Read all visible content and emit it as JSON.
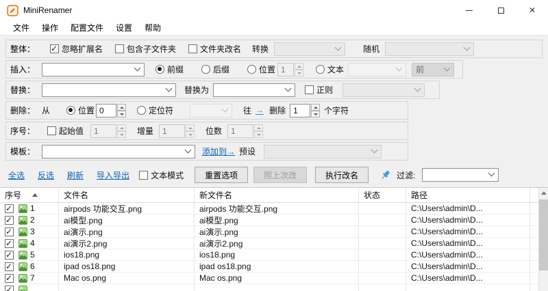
{
  "window": {
    "title": "MiniRenamer"
  },
  "menu": {
    "items": [
      "文件",
      "操作",
      "配置文件",
      "设置",
      "帮助"
    ]
  },
  "options": {
    "overall": {
      "label": "整体：",
      "ignore_ext": "忽略扩展名",
      "include_subfolders": "包含子文件夹",
      "rename_folders": "文件夹改名",
      "convert": "转换",
      "random": "随机"
    },
    "insert": {
      "label": "插入：",
      "prefix": "前缀",
      "suffix": "后缀",
      "position": "位置",
      "position_value": "1",
      "text": "文本",
      "front": "前"
    },
    "replace": {
      "label": "替换：",
      "with_label": "替换为",
      "regex": "正则"
    },
    "remove": {
      "label": "删除：",
      "from": "从",
      "position": "位置",
      "position_value": "0",
      "locator": "定位符",
      "toward": "往",
      "arrow": "→",
      "delete_label": "删除",
      "count_value": "1",
      "chars": "个字符"
    },
    "serial": {
      "label": "序号：",
      "start": "起始值",
      "start_value": "1",
      "increment": "增量",
      "increment_value": "1",
      "digits": "位数",
      "digits_value": "1"
    },
    "template": {
      "label": "模板：",
      "add_to": "添加到→",
      "preset": "预设"
    }
  },
  "toolbar": {
    "select_all": "全选",
    "invert_selection": "反选",
    "refresh": "刷新",
    "import_export": "导入导出",
    "text_mode": "文本模式",
    "reset_options": "重置选项",
    "redo_last": "照上次改",
    "execute": "执行改名",
    "filter_label": "过滤:"
  },
  "table": {
    "headers": {
      "num": "序号",
      "name": "文件名",
      "new_name": "新文件名",
      "status": "状态",
      "path": "路径"
    },
    "rows": [
      {
        "num": "1",
        "name": "airpods 功能交互.png",
        "new_name": "airpods 功能交互.png",
        "status": "",
        "path": "C:\\Users\\admin\\D..."
      },
      {
        "num": "2",
        "name": "ai模型.png",
        "new_name": "ai模型.png",
        "status": "",
        "path": "C:\\Users\\admin\\D..."
      },
      {
        "num": "3",
        "name": "ai演示.png",
        "new_name": "ai演示.png",
        "status": "",
        "path": "C:\\Users\\admin\\D..."
      },
      {
        "num": "4",
        "name": "ai演示2.png",
        "new_name": "ai演示2.png",
        "status": "",
        "path": "C:\\Users\\admin\\D..."
      },
      {
        "num": "5",
        "name": "ios18.png",
        "new_name": "ios18.png",
        "status": "",
        "path": "C:\\Users\\admin\\D..."
      },
      {
        "num": "6",
        "name": "ipad os18.png",
        "new_name": "ipad os18.png",
        "status": "",
        "path": "C:\\Users\\admin\\D..."
      },
      {
        "num": "7",
        "name": "Mac os.png",
        "new_name": "Mac os.png",
        "status": "",
        "path": "C:\\Users\\admin\\D..."
      }
    ]
  },
  "colors": {
    "accent_orange": "#e8821c",
    "link_blue": "#0a63c0",
    "pin_blue": "#3d9be9",
    "file_icon_green": "#7cb342"
  }
}
